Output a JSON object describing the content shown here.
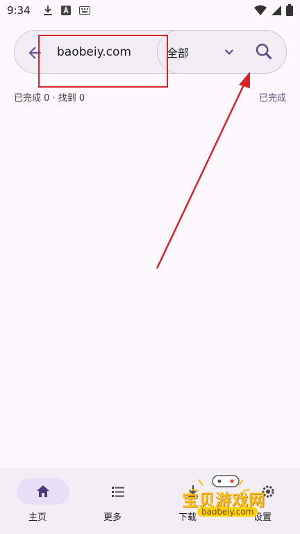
{
  "status_bar": {
    "time": "9:34",
    "icons_left": [
      "download-icon",
      "text-a-icon",
      "keyboard-icon"
    ],
    "icons_right": [
      "wifi-icon",
      "signal-icon",
      "battery-icon"
    ]
  },
  "search": {
    "query": "baobeiy.com",
    "scope_label": "全部"
  },
  "results": {
    "status_text": "已完成 0 · 找到 0",
    "done_label": "已完成"
  },
  "bottom_nav": {
    "items": [
      {
        "label": "主页",
        "icon": "home-icon",
        "active": true
      },
      {
        "label": "更多",
        "icon": "list-icon",
        "active": false
      },
      {
        "label": "下载",
        "icon": "download-icon",
        "active": false
      },
      {
        "label": "设置",
        "icon": "gear-icon",
        "active": false
      }
    ]
  },
  "watermark": {
    "text": "宝贝游戏网",
    "url": "baobeiy.com"
  },
  "colors": {
    "accent": "#6750a4",
    "annotation": "#d8232a",
    "background": "#fdf8fd",
    "nav_bg": "#f3edf5",
    "active_pill": "#e8def8"
  }
}
